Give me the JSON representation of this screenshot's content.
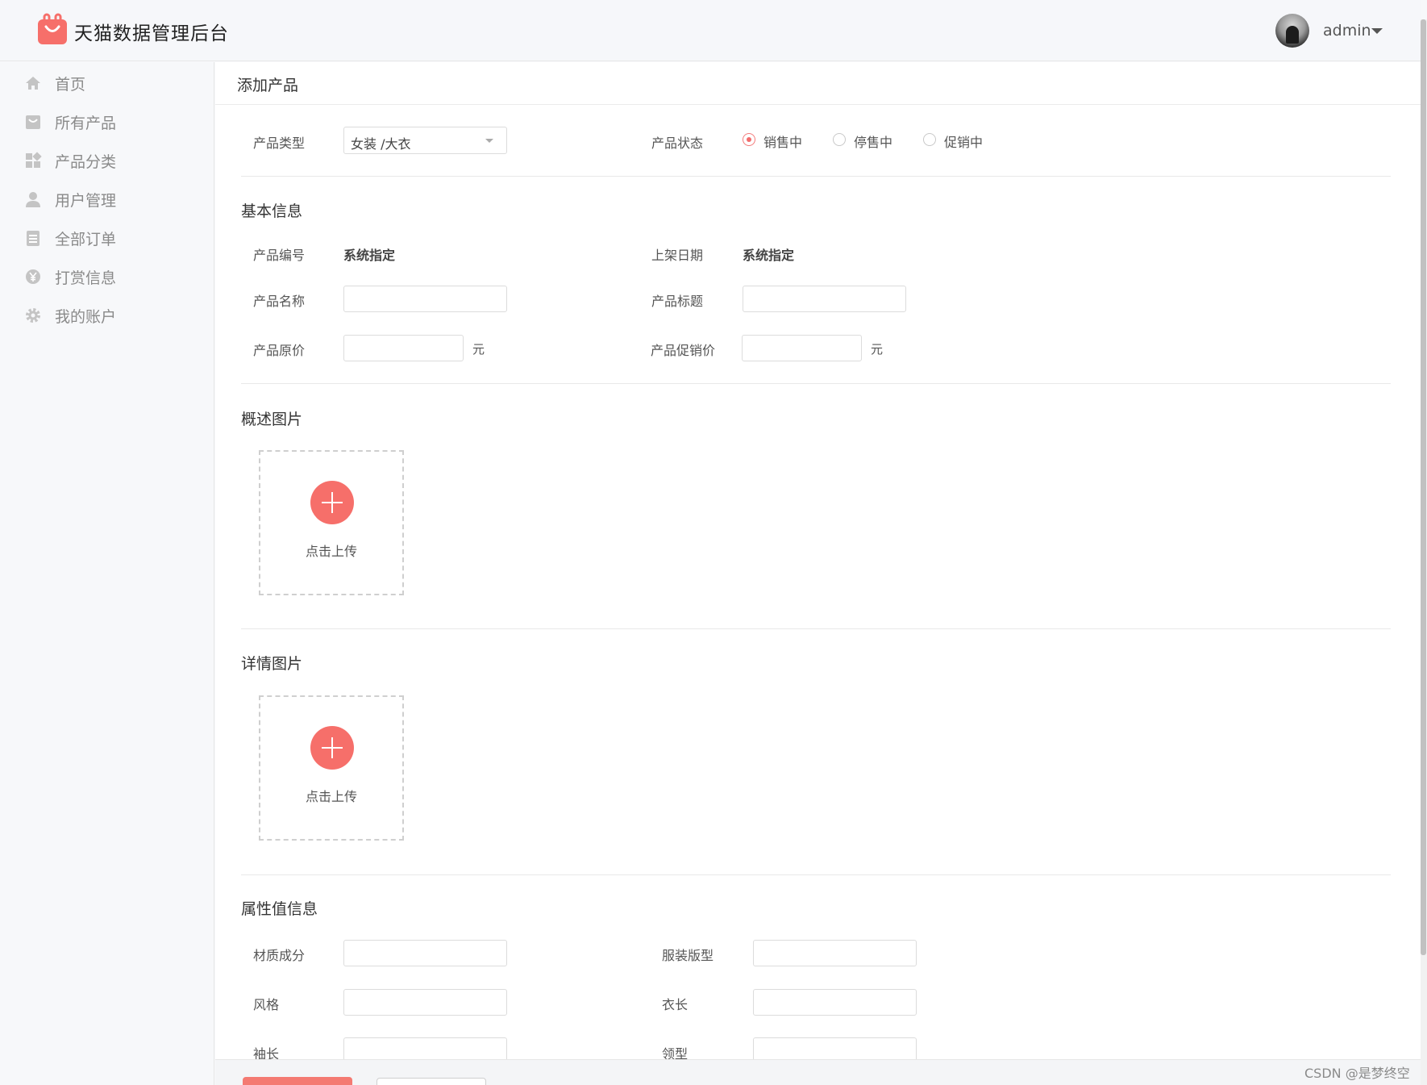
{
  "header": {
    "title": "天猫数据管理后台",
    "user_name": "admin",
    "brand_color": "#f66f6a"
  },
  "sidebar": {
    "items": [
      {
        "label": "首页",
        "icon": "home-icon"
      },
      {
        "label": "所有产品",
        "icon": "bag-icon"
      },
      {
        "label": "产品分类",
        "icon": "category-icon"
      },
      {
        "label": "用户管理",
        "icon": "user-icon"
      },
      {
        "label": "全部订单",
        "icon": "order-icon"
      },
      {
        "label": "打赏信息",
        "icon": "yen-icon"
      },
      {
        "label": "我的账户",
        "icon": "gear-icon"
      }
    ]
  },
  "page": {
    "title": "添加产品"
  },
  "type_row": {
    "type_label": "产品类型",
    "type_value": "女装 /大衣",
    "status_label": "产品状态",
    "status_options": [
      "销售中",
      "停售中",
      "促销中"
    ],
    "status_selected": "销售中"
  },
  "basic": {
    "title": "基本信息",
    "id_label": "产品编号",
    "id_value": "系统指定",
    "date_label": "上架日期",
    "date_value": "系统指定",
    "name_label": "产品名称",
    "name_value": "",
    "subtitle_label": "产品标题",
    "subtitle_value": "",
    "price_label": "产品原价",
    "price_value": "",
    "price_unit": "元",
    "sale_label": "产品促销价",
    "sale_value": "",
    "sale_unit": "元"
  },
  "overview_images": {
    "title": "概述图片",
    "upload_label": "点击上传"
  },
  "detail_images": {
    "title": "详情图片",
    "upload_label": "点击上传"
  },
  "attributes": {
    "title": "属性值信息",
    "fields": [
      {
        "label": "材质成分",
        "value": ""
      },
      {
        "label": "服装版型",
        "value": ""
      },
      {
        "label": "风格",
        "value": ""
      },
      {
        "label": "衣长",
        "value": ""
      },
      {
        "label": "袖长",
        "value": ""
      },
      {
        "label": "领型",
        "value": ""
      }
    ]
  },
  "watermark": "CSDN @是梦终空"
}
